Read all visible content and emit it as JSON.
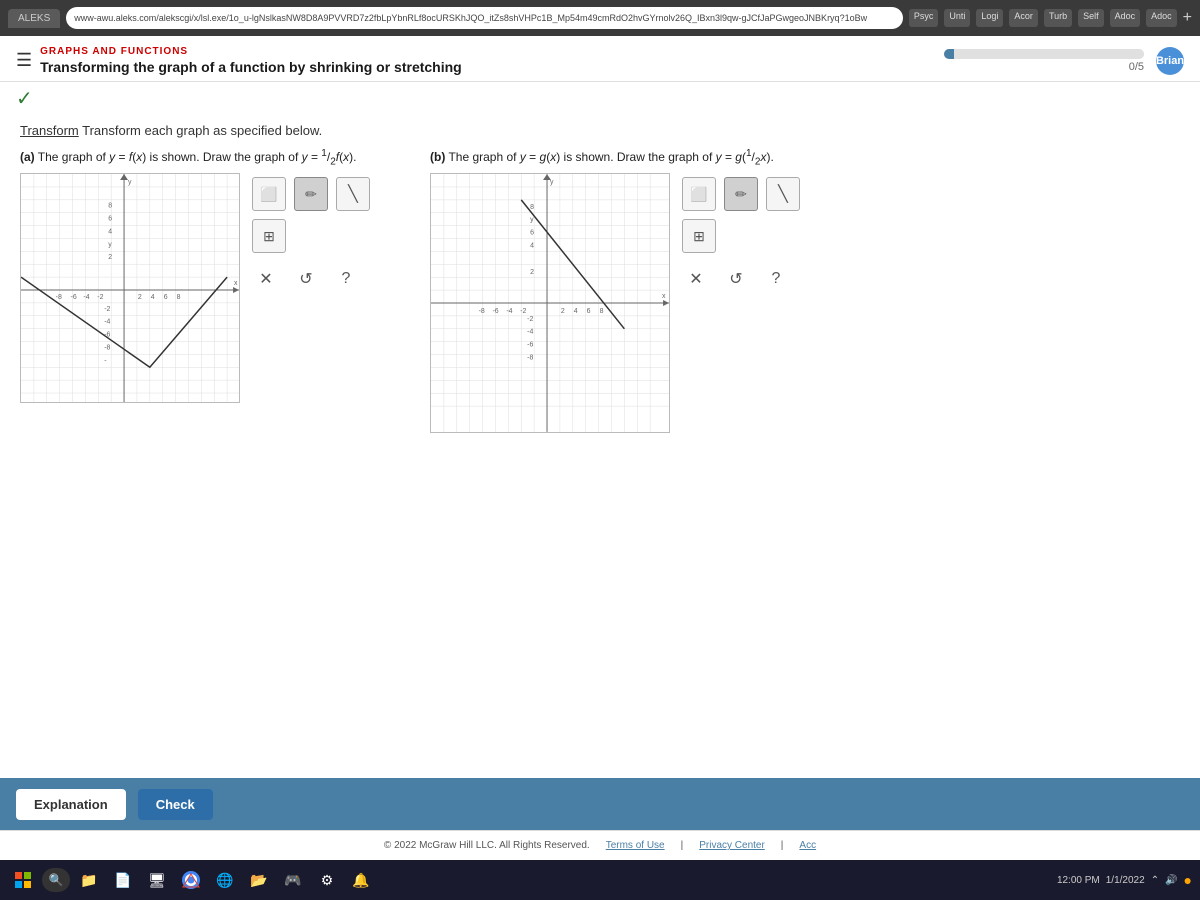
{
  "browser": {
    "url": "www-awu.aleks.com/alekscgi/x/lsl.exe/1o_u-lgNslkasNW8D8A9PVVRD7z2fbLpYbnRLf8ocURSKhJQO_itZs8shVHPc1B_Mp54m49cmRdO2hvGYrnolv26Q_IBxn3l9qw-gJCfJaPGwgeoJNBKryq?1oBw",
    "tabs": [
      "Psyc",
      "Unti",
      "Logi",
      "Acor",
      "Turb",
      "Self",
      "Adoc",
      "Adoc"
    ]
  },
  "header": {
    "section_label": "GRAPHS AND FUNCTIONS",
    "title": "Transforming the graph of a function by shrinking or stretching",
    "progress": "0/5",
    "user": "Brian"
  },
  "content": {
    "instruction": "Transform each graph as specified below.",
    "part_a": {
      "label": "(a) The graph of y = f(x) is shown. Draw the graph of y = ½ f(x)."
    },
    "part_b": {
      "label": "(b) The graph of y = g(x) is shown. Draw the graph of y = g(½x)."
    }
  },
  "tools": {
    "draw_icon": "✎",
    "eraser_icon": "⬜",
    "crosshair_icon": "⊞",
    "close_icon": "✕",
    "undo_icon": "↺",
    "help_icon": "?",
    "pencil_icon": "✏",
    "line_icon": "╲"
  },
  "buttons": {
    "explanation": "Explanation",
    "check": "Check"
  },
  "footer": {
    "copyright": "© 2022 McGraw Hill LLC. All Rights Reserved.",
    "terms": "Terms of Use",
    "privacy": "Privacy Center",
    "acc": "Acc"
  }
}
